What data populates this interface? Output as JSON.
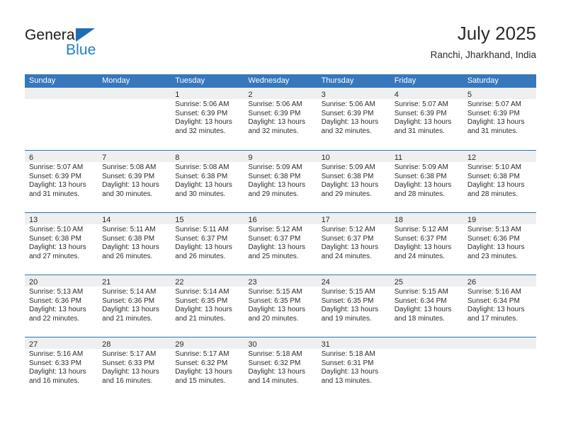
{
  "logo": {
    "word_top": "General",
    "word_bottom": "Blue",
    "triangle_icon": "triangle-icon",
    "accent_color": "#1f7ec4"
  },
  "header": {
    "title": "July 2025",
    "subtitle": "Ranchi, Jharkhand, India"
  },
  "theme": {
    "header_blue": "#3777bc",
    "row_rule_blue": "#2e72b5",
    "day_band_gray": "#efefef",
    "text_color": "#2b2b2b"
  },
  "weekdays": [
    "Sunday",
    "Monday",
    "Tuesday",
    "Wednesday",
    "Thursday",
    "Friday",
    "Saturday"
  ],
  "weeks": [
    [
      {
        "day": "",
        "empty": true
      },
      {
        "day": "",
        "empty": true
      },
      {
        "day": "1",
        "sunrise": "Sunrise: 5:06 AM",
        "sunset": "Sunset: 6:39 PM",
        "daylight1": "Daylight: 13 hours",
        "daylight2": "and 32 minutes."
      },
      {
        "day": "2",
        "sunrise": "Sunrise: 5:06 AM",
        "sunset": "Sunset: 6:39 PM",
        "daylight1": "Daylight: 13 hours",
        "daylight2": "and 32 minutes."
      },
      {
        "day": "3",
        "sunrise": "Sunrise: 5:06 AM",
        "sunset": "Sunset: 6:39 PM",
        "daylight1": "Daylight: 13 hours",
        "daylight2": "and 32 minutes."
      },
      {
        "day": "4",
        "sunrise": "Sunrise: 5:07 AM",
        "sunset": "Sunset: 6:39 PM",
        "daylight1": "Daylight: 13 hours",
        "daylight2": "and 31 minutes."
      },
      {
        "day": "5",
        "sunrise": "Sunrise: 5:07 AM",
        "sunset": "Sunset: 6:39 PM",
        "daylight1": "Daylight: 13 hours",
        "daylight2": "and 31 minutes."
      }
    ],
    [
      {
        "day": "6",
        "sunrise": "Sunrise: 5:07 AM",
        "sunset": "Sunset: 6:39 PM",
        "daylight1": "Daylight: 13 hours",
        "daylight2": "and 31 minutes."
      },
      {
        "day": "7",
        "sunrise": "Sunrise: 5:08 AM",
        "sunset": "Sunset: 6:39 PM",
        "daylight1": "Daylight: 13 hours",
        "daylight2": "and 30 minutes."
      },
      {
        "day": "8",
        "sunrise": "Sunrise: 5:08 AM",
        "sunset": "Sunset: 6:38 PM",
        "daylight1": "Daylight: 13 hours",
        "daylight2": "and 30 minutes."
      },
      {
        "day": "9",
        "sunrise": "Sunrise: 5:09 AM",
        "sunset": "Sunset: 6:38 PM",
        "daylight1": "Daylight: 13 hours",
        "daylight2": "and 29 minutes."
      },
      {
        "day": "10",
        "sunrise": "Sunrise: 5:09 AM",
        "sunset": "Sunset: 6:38 PM",
        "daylight1": "Daylight: 13 hours",
        "daylight2": "and 29 minutes."
      },
      {
        "day": "11",
        "sunrise": "Sunrise: 5:09 AM",
        "sunset": "Sunset: 6:38 PM",
        "daylight1": "Daylight: 13 hours",
        "daylight2": "and 28 minutes."
      },
      {
        "day": "12",
        "sunrise": "Sunrise: 5:10 AM",
        "sunset": "Sunset: 6:38 PM",
        "daylight1": "Daylight: 13 hours",
        "daylight2": "and 28 minutes."
      }
    ],
    [
      {
        "day": "13",
        "sunrise": "Sunrise: 5:10 AM",
        "sunset": "Sunset: 6:38 PM",
        "daylight1": "Daylight: 13 hours",
        "daylight2": "and 27 minutes."
      },
      {
        "day": "14",
        "sunrise": "Sunrise: 5:11 AM",
        "sunset": "Sunset: 6:38 PM",
        "daylight1": "Daylight: 13 hours",
        "daylight2": "and 26 minutes."
      },
      {
        "day": "15",
        "sunrise": "Sunrise: 5:11 AM",
        "sunset": "Sunset: 6:37 PM",
        "daylight1": "Daylight: 13 hours",
        "daylight2": "and 26 minutes."
      },
      {
        "day": "16",
        "sunrise": "Sunrise: 5:12 AM",
        "sunset": "Sunset: 6:37 PM",
        "daylight1": "Daylight: 13 hours",
        "daylight2": "and 25 minutes."
      },
      {
        "day": "17",
        "sunrise": "Sunrise: 5:12 AM",
        "sunset": "Sunset: 6:37 PM",
        "daylight1": "Daylight: 13 hours",
        "daylight2": "and 24 minutes."
      },
      {
        "day": "18",
        "sunrise": "Sunrise: 5:12 AM",
        "sunset": "Sunset: 6:37 PM",
        "daylight1": "Daylight: 13 hours",
        "daylight2": "and 24 minutes."
      },
      {
        "day": "19",
        "sunrise": "Sunrise: 5:13 AM",
        "sunset": "Sunset: 6:36 PM",
        "daylight1": "Daylight: 13 hours",
        "daylight2": "and 23 minutes."
      }
    ],
    [
      {
        "day": "20",
        "sunrise": "Sunrise: 5:13 AM",
        "sunset": "Sunset: 6:36 PM",
        "daylight1": "Daylight: 13 hours",
        "daylight2": "and 22 minutes."
      },
      {
        "day": "21",
        "sunrise": "Sunrise: 5:14 AM",
        "sunset": "Sunset: 6:36 PM",
        "daylight1": "Daylight: 13 hours",
        "daylight2": "and 21 minutes."
      },
      {
        "day": "22",
        "sunrise": "Sunrise: 5:14 AM",
        "sunset": "Sunset: 6:35 PM",
        "daylight1": "Daylight: 13 hours",
        "daylight2": "and 21 minutes."
      },
      {
        "day": "23",
        "sunrise": "Sunrise: 5:15 AM",
        "sunset": "Sunset: 6:35 PM",
        "daylight1": "Daylight: 13 hours",
        "daylight2": "and 20 minutes."
      },
      {
        "day": "24",
        "sunrise": "Sunrise: 5:15 AM",
        "sunset": "Sunset: 6:35 PM",
        "daylight1": "Daylight: 13 hours",
        "daylight2": "and 19 minutes."
      },
      {
        "day": "25",
        "sunrise": "Sunrise: 5:15 AM",
        "sunset": "Sunset: 6:34 PM",
        "daylight1": "Daylight: 13 hours",
        "daylight2": "and 18 minutes."
      },
      {
        "day": "26",
        "sunrise": "Sunrise: 5:16 AM",
        "sunset": "Sunset: 6:34 PM",
        "daylight1": "Daylight: 13 hours",
        "daylight2": "and 17 minutes."
      }
    ],
    [
      {
        "day": "27",
        "sunrise": "Sunrise: 5:16 AM",
        "sunset": "Sunset: 6:33 PM",
        "daylight1": "Daylight: 13 hours",
        "daylight2": "and 16 minutes."
      },
      {
        "day": "28",
        "sunrise": "Sunrise: 5:17 AM",
        "sunset": "Sunset: 6:33 PM",
        "daylight1": "Daylight: 13 hours",
        "daylight2": "and 16 minutes."
      },
      {
        "day": "29",
        "sunrise": "Sunrise: 5:17 AM",
        "sunset": "Sunset: 6:32 PM",
        "daylight1": "Daylight: 13 hours",
        "daylight2": "and 15 minutes."
      },
      {
        "day": "30",
        "sunrise": "Sunrise: 5:18 AM",
        "sunset": "Sunset: 6:32 PM",
        "daylight1": "Daylight: 13 hours",
        "daylight2": "and 14 minutes."
      },
      {
        "day": "31",
        "sunrise": "Sunrise: 5:18 AM",
        "sunset": "Sunset: 6:31 PM",
        "daylight1": "Daylight: 13 hours",
        "daylight2": "and 13 minutes."
      },
      {
        "day": "",
        "empty": true
      },
      {
        "day": "",
        "empty": true
      }
    ]
  ]
}
